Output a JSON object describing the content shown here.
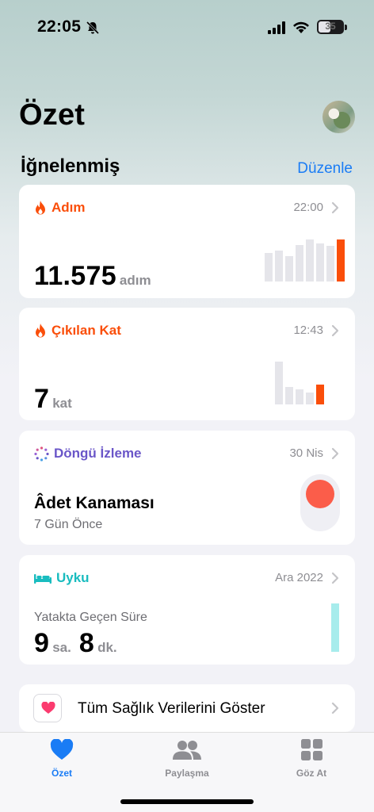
{
  "status": {
    "time": "22:05",
    "battery": "35"
  },
  "header": {
    "title": "Özet"
  },
  "pinned": {
    "title": "İğnelenmiş",
    "edit_label": "Düzenle"
  },
  "cards": {
    "steps": {
      "title": "Adım",
      "time": "22:00",
      "value": "11.575",
      "unit": "adım",
      "accent": "#fa4e0a",
      "chart_levels": [
        0.62,
        0.68,
        0.56,
        0.8,
        0.92,
        0.82,
        0.78,
        0.92
      ],
      "highlight_index": 7
    },
    "floors": {
      "title": "Çıkılan Kat",
      "time": "12:43",
      "value": "7",
      "unit": "kat",
      "accent": "#fa4e0a",
      "chart_levels": [
        1.0,
        0.4,
        0.35,
        0.28,
        0.46
      ],
      "highlight_index": 4
    },
    "cycle": {
      "title": "Döngü İzleme",
      "date": "30 Nis",
      "headline": "Âdet Kanaması",
      "sub": "7 Gün Önce",
      "accent": "#6a56c8"
    },
    "sleep": {
      "title": "Uyku",
      "date": "Ara 2022",
      "label": "Yatakta Geçen Süre",
      "hours": "9",
      "hours_unit": "sa.",
      "minutes": "8",
      "minutes_unit": "dk.",
      "accent": "#19bcbf"
    }
  },
  "show_all": {
    "label": "Tüm Sağlık Verilerini Göster"
  },
  "tabs": [
    {
      "label": "Özet",
      "icon": "heart-icon",
      "active": true
    },
    {
      "label": "Paylaşma",
      "icon": "people-icon",
      "active": false
    },
    {
      "label": "Göz At",
      "icon": "grid-icon",
      "active": false
    }
  ]
}
